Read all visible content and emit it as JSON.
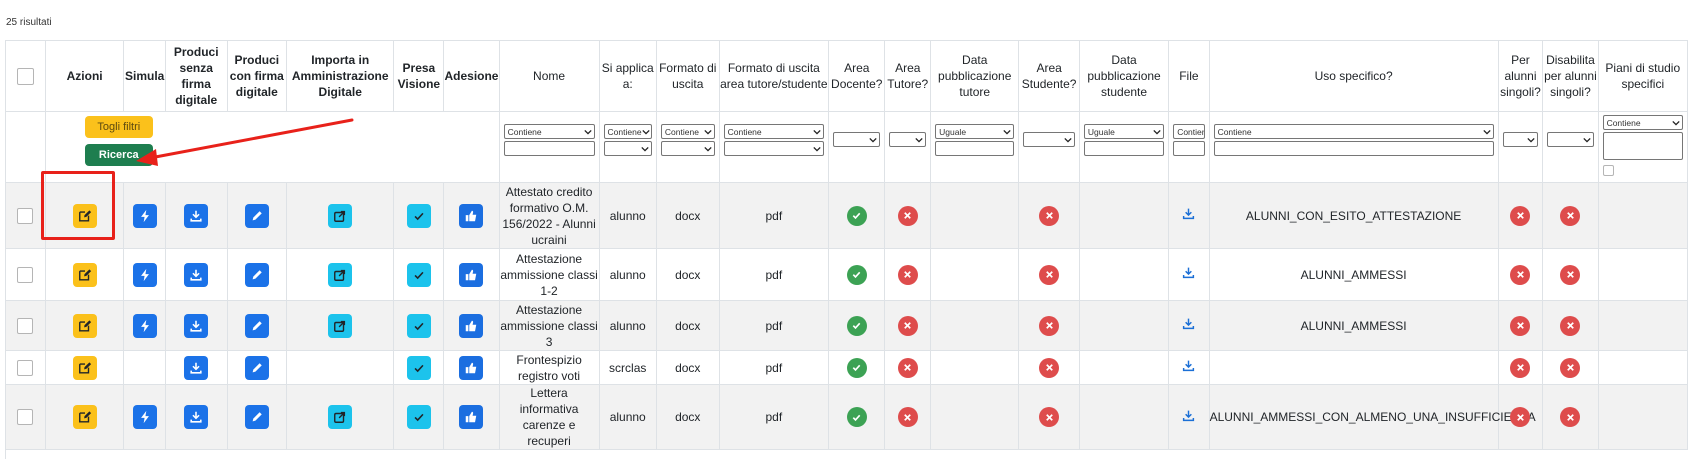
{
  "results_count": "25 risultati",
  "columns": [
    {
      "key": "select",
      "label": ""
    },
    {
      "key": "azioni",
      "label": "Azioni"
    },
    {
      "key": "simula",
      "label": "Simula"
    },
    {
      "key": "senza_firma",
      "label": "Produci senza firma digitale"
    },
    {
      "key": "con_firma",
      "label": "Produci con firma digitale"
    },
    {
      "key": "importa",
      "label": "Importa in Amministrazione Digitale"
    },
    {
      "key": "presa",
      "label": "Presa Visione"
    },
    {
      "key": "adesione",
      "label": "Adesione"
    },
    {
      "key": "nome",
      "label": "Nome"
    },
    {
      "key": "si_applica",
      "label": "Si applica a:"
    },
    {
      "key": "formato",
      "label": "Formato di uscita"
    },
    {
      "key": "formato_area",
      "label": "Formato di uscita area tutore/studente"
    },
    {
      "key": "area_docente",
      "label": "Area Docente?"
    },
    {
      "key": "area_tutore",
      "label": "Area Tutore?"
    },
    {
      "key": "data_tutore",
      "label": "Data pubblicazione tutore"
    },
    {
      "key": "area_studente",
      "label": "Area Studente?"
    },
    {
      "key": "data_studente",
      "label": "Data pubblicazione studente"
    },
    {
      "key": "file",
      "label": "File"
    },
    {
      "key": "uso",
      "label": "Uso specifico?"
    },
    {
      "key": "singoli",
      "label": "Per alunni singoli?"
    },
    {
      "key": "disabilita",
      "label": "Disabilita per alunni singoli?"
    },
    {
      "key": "piani",
      "label": "Piani di studio specifici"
    }
  ],
  "filters": {
    "toggle_label": "Togli filtri",
    "search_label": "Ricerca",
    "nome_op": "Contiene",
    "si_applica_op": "Contiene",
    "formato_op": "Contiene",
    "formato_area_op": "Contiene",
    "data_tutore_op": "Uguale",
    "data_studente_op": "Uguale",
    "file_op": "Contiene",
    "uso_op": "Contiene",
    "piani_op": "Contiene"
  },
  "rows": [
    {
      "nome": "Attestato credito formativo O.M. 156/2022 - Alunni ucraini",
      "si_applica": "alunno",
      "formato": "docx",
      "formato_area": "pdf",
      "uso": "ALUNNI_CON_ESITO_ATTESTAZIONE",
      "simula": true,
      "importa": true,
      "adesione": true
    },
    {
      "nome": "Attestazione ammissione classi 1-2",
      "si_applica": "alunno",
      "formato": "docx",
      "formato_area": "pdf",
      "uso": "ALUNNI_AMMESSI",
      "simula": true,
      "importa": true,
      "adesione": true
    },
    {
      "nome": "Attestazione ammissione classi 3",
      "si_applica": "alunno",
      "formato": "docx",
      "formato_area": "pdf",
      "uso": "ALUNNI_AMMESSI",
      "simula": true,
      "importa": true,
      "adesione": true
    },
    {
      "nome": "Frontespizio registro voti",
      "si_applica": "scrclas",
      "formato": "docx",
      "formato_area": "pdf",
      "uso": "",
      "simula": false,
      "importa": false,
      "adesione": true
    },
    {
      "nome": "Lettera informativa carenze e recuperi",
      "si_applica": "alunno",
      "formato": "docx",
      "formato_area": "pdf",
      "uso": "ALUNNI_AMMESSI_CON_ALMENO_UNA_INSUFFICIENZA",
      "simula": true,
      "importa": true,
      "adesione": true
    }
  ],
  "colors": {
    "yellow": "#fbc11b",
    "blue": "#1b72e8",
    "cyan": "#1cc3ec",
    "green": "#3ca254",
    "red": "#de4c4c",
    "annotation": "#e8211a"
  }
}
